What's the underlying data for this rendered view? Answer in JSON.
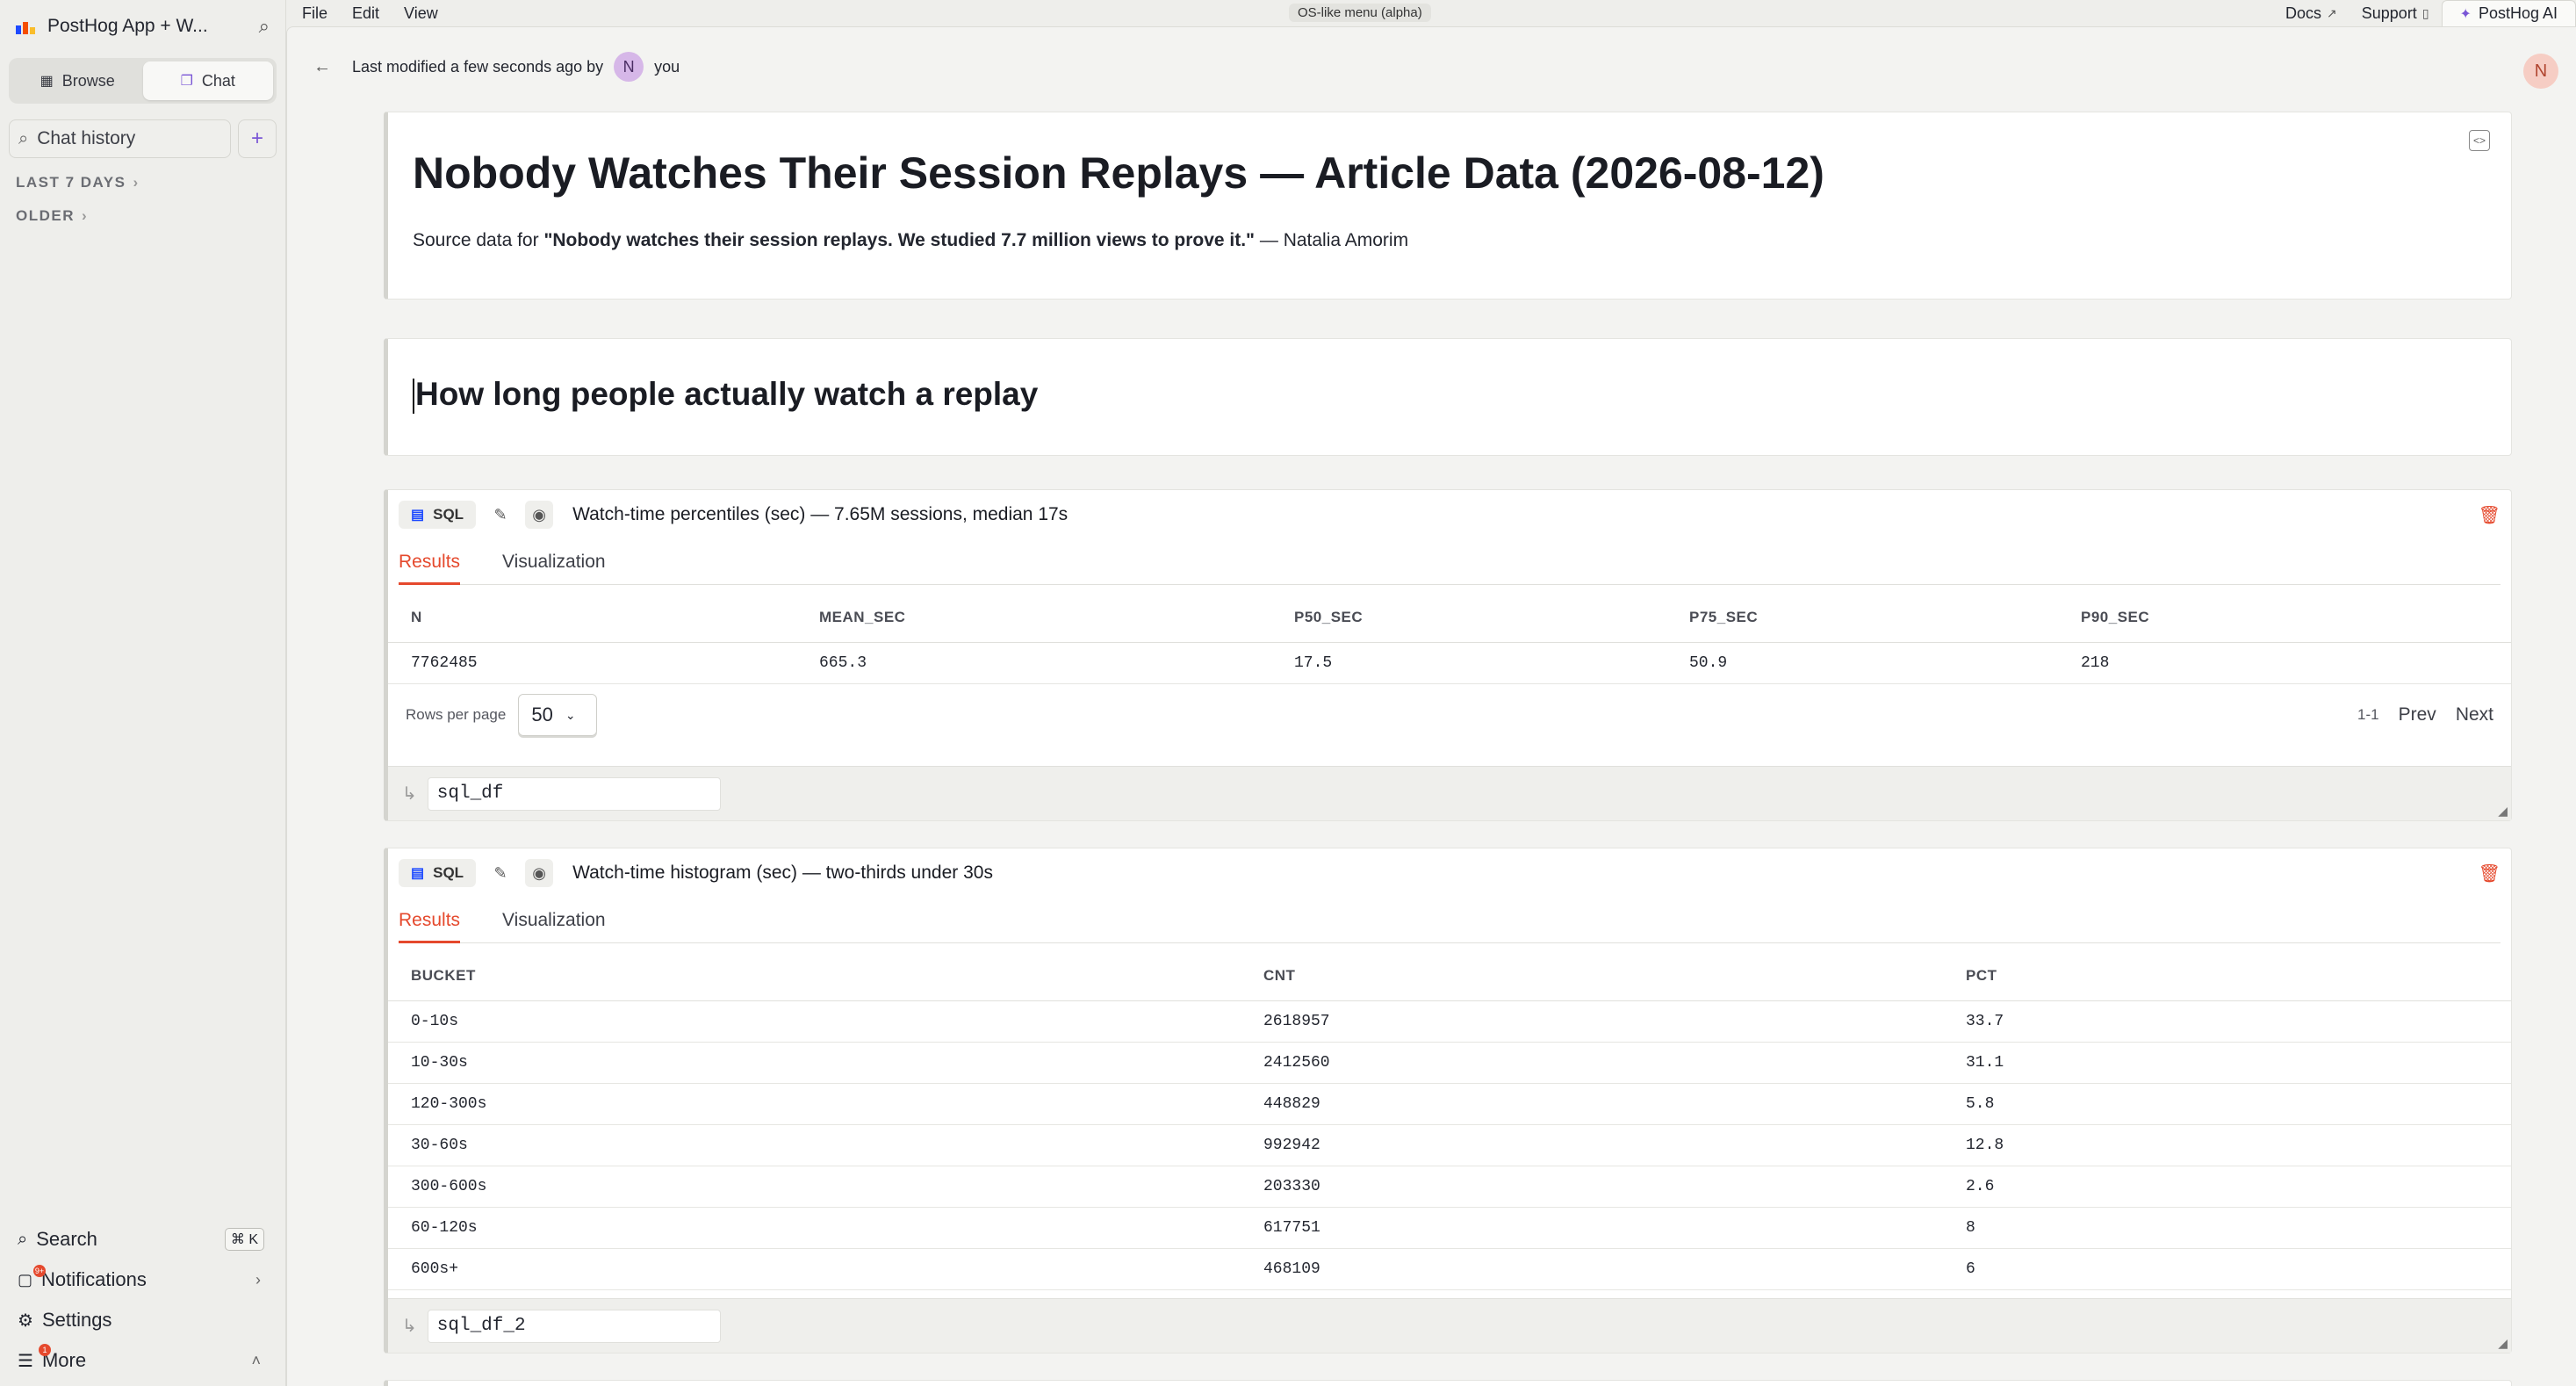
{
  "menubar": {
    "items": [
      "File",
      "Edit",
      "View"
    ],
    "center_label": "OS-like menu (alpha)",
    "docs": "Docs",
    "support": "Support",
    "ai": "PostHog AI"
  },
  "sidebar": {
    "project": "PostHog App + W...",
    "browse": "Browse",
    "chat": "Chat",
    "chat_history_placeholder": "Chat history",
    "groups": [
      "LAST 7 DAYS",
      "OLDER"
    ],
    "search": "Search",
    "search_shortcut": "⌘ K",
    "notifications": "Notifications",
    "notifications_badge": "9+",
    "settings": "Settings",
    "more": "More",
    "more_badge": "1"
  },
  "topinfo": {
    "modified_text": "Last modified a few seconds ago by",
    "avatar_letter": "N",
    "author": "you",
    "user_avatar_letter": "N"
  },
  "doc": {
    "title": "Nobody Watches Their Session Replays — Article Data (2026-08-12)",
    "sub_prefix": "Source data for",
    "sub_bold": "\"Nobody watches their session replays. We studied 7.7 million views to prove it.\"",
    "sub_suffix": "— Natalia Amorim",
    "heading": "How long people actually watch a replay"
  },
  "blocks": [
    {
      "pill": "SQL",
      "title": "Watch-time percentiles (sec) — 7.65M sessions, median 17s",
      "tabs": [
        "Results",
        "Visualization"
      ],
      "columns": [
        "N",
        "MEAN_SEC",
        "P50_SEC",
        "P75_SEC",
        "P90_SEC"
      ],
      "rows": [
        [
          "7762485",
          "665.3",
          "17.5",
          "50.9",
          "218"
        ]
      ],
      "rows_per_page_label": "Rows per page",
      "rows_per_page": "50",
      "range": "1-1",
      "prev": "Prev",
      "next": "Next",
      "df_name": "sql_df"
    },
    {
      "pill": "SQL",
      "title": "Watch-time histogram (sec) — two-thirds under 30s",
      "tabs": [
        "Results",
        "Visualization"
      ],
      "columns": [
        "BUCKET",
        "CNT",
        "PCT"
      ],
      "rows": [
        [
          "0-10s",
          "2618957",
          "33.7"
        ],
        [
          "10-30s",
          "2412560",
          "31.1"
        ],
        [
          "120-300s",
          "448829",
          "5.8"
        ],
        [
          "30-60s",
          "992942",
          "12.8"
        ],
        [
          "300-600s",
          "203330",
          "2.6"
        ],
        [
          "60-120s",
          "617751",
          "8"
        ],
        [
          "600s+",
          "468109",
          "6"
        ]
      ],
      "df_name": "sql_df_2"
    }
  ],
  "colors": {
    "accent": "#e5492d",
    "ai_purple": "#7a56d6",
    "avatar_bg": "#d6b7e8"
  }
}
